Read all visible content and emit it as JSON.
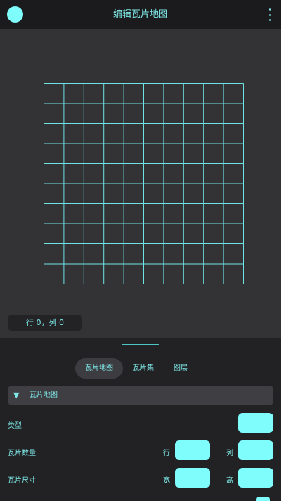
{
  "header": {
    "title": "编辑瓦片地图",
    "avatar_icon": "avatar-circle",
    "menu_icon": "more-vert-icon"
  },
  "canvas": {
    "grid": {
      "rows": 10,
      "cols": 10
    },
    "coords": "行 0，列 0"
  },
  "panel": {
    "tabs": [
      {
        "label": "瓦片地图",
        "active": true
      },
      {
        "label": "瓦片集",
        "active": false
      },
      {
        "label": "图层",
        "active": false
      }
    ],
    "section": {
      "label": "瓦片地图",
      "expand_icon": "triangle-down-icon"
    },
    "properties": {
      "type_label": "类型",
      "count_label": "瓦片数量",
      "count_row_label": "行",
      "count_col_label": "列",
      "size_label": "瓦片尺寸",
      "size_width_label": "宽",
      "size_height_label": "高"
    }
  },
  "colors": {
    "accent": "#7ffcfc",
    "text": "#7fe9e9",
    "topbar": "#1b1b1d",
    "canvas": "#333335",
    "panel": "#222224",
    "grid_line": "#6fe3e3"
  }
}
